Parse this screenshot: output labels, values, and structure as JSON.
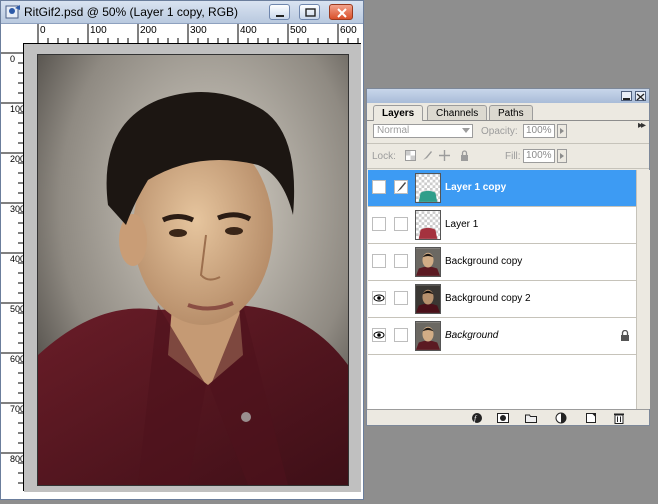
{
  "document": {
    "title": "RitGif2.psd @ 50% (Layer 1 copy, RGB)",
    "app_icon": "photoshop-doc-icon",
    "buttons": [
      "minimize-icon",
      "restore-icon",
      "close-icon"
    ]
  },
  "rulers": {
    "top": [
      "0",
      "100",
      "200",
      "300",
      "400",
      "500",
      "600"
    ],
    "left": [
      "0",
      "100",
      "200",
      "300",
      "400",
      "500",
      "600",
      "700",
      "800"
    ]
  },
  "palette": {
    "tabs": [
      "Layers",
      "Channels",
      "Paths"
    ],
    "active_tab": "Layers",
    "blend_mode": "Normal",
    "opacity_label": "Opacity:",
    "opacity_value": "100%",
    "lock_label": "Lock:",
    "fill_label": "Fill:",
    "fill_value": "100%",
    "layers": [
      {
        "name": "Layer 1 copy",
        "visible": false,
        "selected": true,
        "thumb": "transparent-shirt"
      },
      {
        "name": "Layer 1",
        "visible": false,
        "selected": false,
        "thumb": "transparent-shirt"
      },
      {
        "name": "Background copy",
        "visible": false,
        "selected": false,
        "thumb": "portrait"
      },
      {
        "name": "Background copy 2",
        "visible": true,
        "selected": false,
        "thumb": "portrait-dark"
      },
      {
        "name": "Background",
        "visible": true,
        "selected": false,
        "thumb": "portrait",
        "locked": true,
        "italic": true
      }
    ],
    "footer_icons": [
      "layer-style-icon",
      "layer-mask-icon",
      "new-group-icon",
      "adjustment-layer-icon",
      "new-layer-icon",
      "trash-icon"
    ]
  },
  "colors": {
    "selection": "#3d9bf3",
    "shirt": "#5b1a22",
    "background_gray": "#8e8e8e"
  }
}
